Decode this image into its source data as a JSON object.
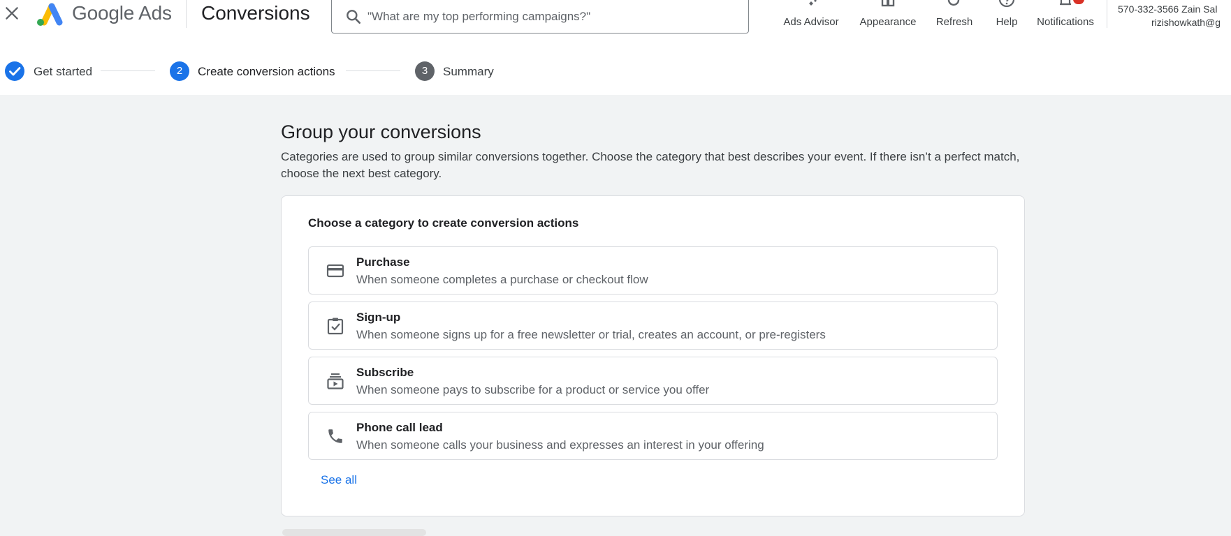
{
  "app": {
    "brand": "Google Ads",
    "page_title": "Conversions"
  },
  "search": {
    "placeholder": "\"What are my top performing campaigns?\""
  },
  "toolbar": {
    "items": [
      {
        "label": "Ads Advisor",
        "icon": "sparkle-icon"
      },
      {
        "label": "Appearance",
        "icon": "appearance-icon"
      },
      {
        "label": "Refresh",
        "icon": "refresh-icon"
      },
      {
        "label": "Help",
        "icon": "help-icon"
      },
      {
        "label": "Notifications",
        "icon": "bell-icon"
      }
    ]
  },
  "account": {
    "line1": "570-332-3566 Zain Sal",
    "line2": "rizishowkath@g"
  },
  "stepper": {
    "steps": [
      {
        "label": "Get started",
        "state": "completed"
      },
      {
        "label": "Create conversion actions",
        "state": "active",
        "number": "2"
      },
      {
        "label": "Summary",
        "state": "pending",
        "number": "3"
      }
    ]
  },
  "main": {
    "heading": "Group your conversions",
    "description": "Categories are used to group similar conversions together. Choose the category that best describes your event. If there isn’t a perfect match, choose the next best category.",
    "card": {
      "title": "Choose a category to create conversion actions",
      "options": [
        {
          "title": "Purchase",
          "description": "When someone completes a purchase or checkout flow",
          "icon": "credit-card-icon"
        },
        {
          "title": "Sign-up",
          "description": "When someone signs up for a free newsletter or trial, creates an account, or pre-registers",
          "icon": "clipboard-check-icon"
        },
        {
          "title": "Subscribe",
          "description": "When someone pays to subscribe for a product or service you offer",
          "icon": "subscriptions-icon"
        },
        {
          "title": "Phone call lead",
          "description": "When someone calls your business and expresses an interest in your offering",
          "icon": "phone-icon"
        }
      ],
      "see_all": "See all"
    }
  },
  "colors": {
    "primary": "#1a73e8",
    "step_pending": "#5f6368",
    "notification_badge": "#d93025",
    "background": "#f1f3f4"
  }
}
